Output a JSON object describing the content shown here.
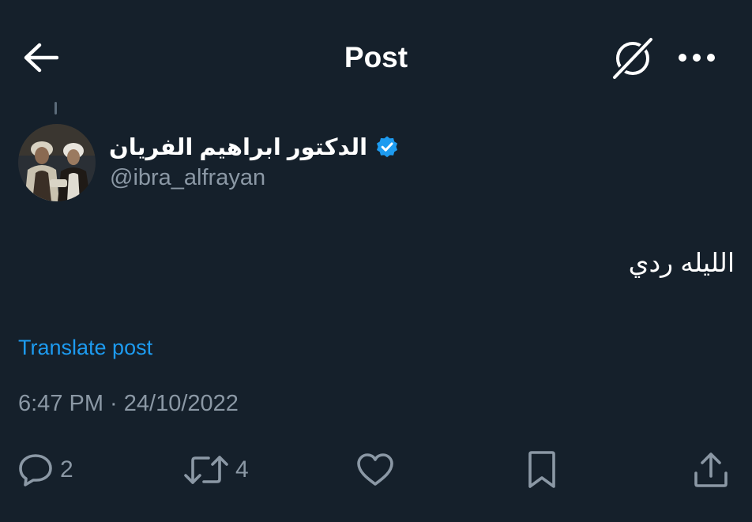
{
  "header": {
    "title": "Post",
    "back_icon": "arrow-left-icon",
    "grok_icon": "grok-icon",
    "more_icon": "more-horizontal-icon"
  },
  "author": {
    "display_name": "الدكتور ابراهيم الفريان",
    "handle": "@ibra_alfrayan",
    "verified": true,
    "verified_color": "#1d9bf0"
  },
  "post": {
    "text": "الليله ردي",
    "translate_label": "Translate post",
    "timestamp": "6:47 PM · 24/10/2022"
  },
  "actions": {
    "reply_count": "2",
    "retweet_count": "4",
    "like_icon": "heart-icon",
    "bookmark_icon": "bookmark-icon",
    "share_icon": "share-icon"
  },
  "colors": {
    "background": "#15202b",
    "accent": "#1d9bf0",
    "secondary_text": "#8b98a5"
  }
}
